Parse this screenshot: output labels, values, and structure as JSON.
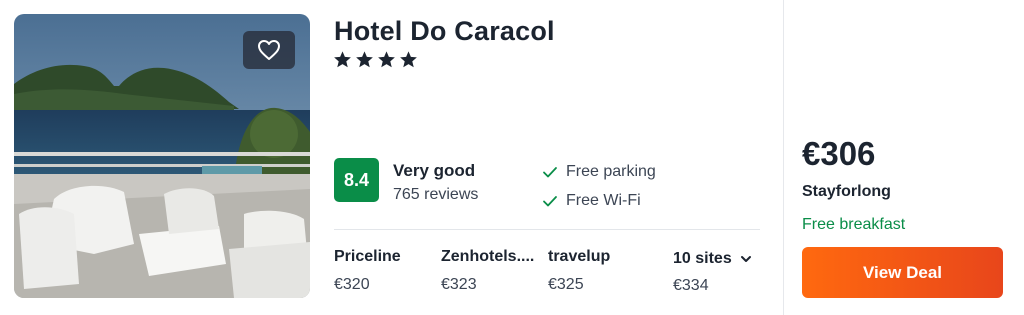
{
  "hotel": {
    "name": "Hotel Do Caracol",
    "star_rating": 4,
    "star_glyph": "★"
  },
  "photo": {
    "favorite_icon": "heart-icon"
  },
  "rating": {
    "score": "8.4",
    "label": "Very good",
    "reviews": "765 reviews",
    "badge_color": "#0a8d48"
  },
  "amenities": [
    {
      "label": "Free parking",
      "icon": "check-icon"
    },
    {
      "label": "Free Wi-Fi",
      "icon": "check-icon"
    }
  ],
  "providers": [
    {
      "name": "Priceline",
      "price": "€320"
    },
    {
      "name": "Zenhotels....",
      "price": "€323"
    },
    {
      "name": "travelup",
      "price": "€325"
    }
  ],
  "more_sites": {
    "label": "10 sites",
    "price": "€334",
    "icon": "chevron-down-icon"
  },
  "deal": {
    "price": "€306",
    "provider": "Stayforlong",
    "perk": "Free breakfast",
    "button_label": "View Deal",
    "button_color": "#ff690f",
    "perk_color": "#0a8d48"
  }
}
